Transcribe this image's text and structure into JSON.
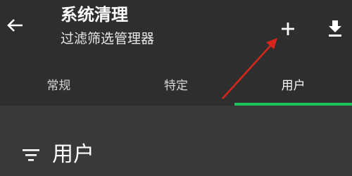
{
  "header": {
    "title": "系统清理",
    "subtitle": "过滤筛选管理器",
    "icons": [
      "back-arrow-icon",
      "plus-icon",
      "download-icon"
    ]
  },
  "tabs": [
    {
      "label": "常规",
      "active": false
    },
    {
      "label": "特定",
      "active": false
    },
    {
      "label": "用户",
      "active": true
    }
  ],
  "section": {
    "title": "用户",
    "icon": "filter-icon"
  },
  "colors": {
    "appbar": "#2e2e2e",
    "content": "#393939",
    "accent": "#1ec25a",
    "annotation": "#d9261c"
  }
}
